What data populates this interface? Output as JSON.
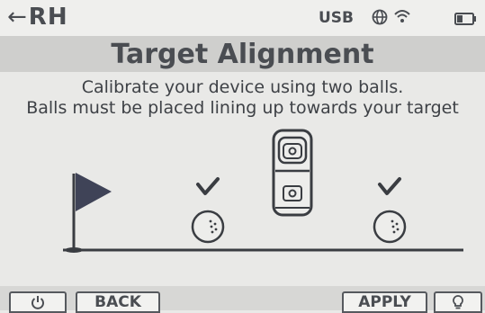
{
  "status_bar": {
    "back_arrow": "←",
    "handedness": "RH",
    "usb": "USB",
    "icons": [
      "globe-icon",
      "wifi-icon",
      "battery-icon"
    ]
  },
  "title": "Target Alignment",
  "instructions": {
    "line1": "Calibrate your device using two balls.",
    "line2": "Balls must be placed lining up towards your target"
  },
  "illustration": {
    "icons": [
      "flag-icon",
      "checkmark-icon",
      "golf-ball-icon",
      "launch-monitor-icon",
      "checkmark-icon",
      "golf-ball-icon"
    ]
  },
  "bottom_bar": {
    "power_icon": "power-icon",
    "back_label": "BACK",
    "apply_label": "APPLY",
    "bulb_icon": "lightbulb-icon"
  },
  "colors": {
    "background": "#e9e9e7",
    "title_banner": "#cfcfcd",
    "foreground": "#4a4d52",
    "flag": "#3f4357"
  }
}
